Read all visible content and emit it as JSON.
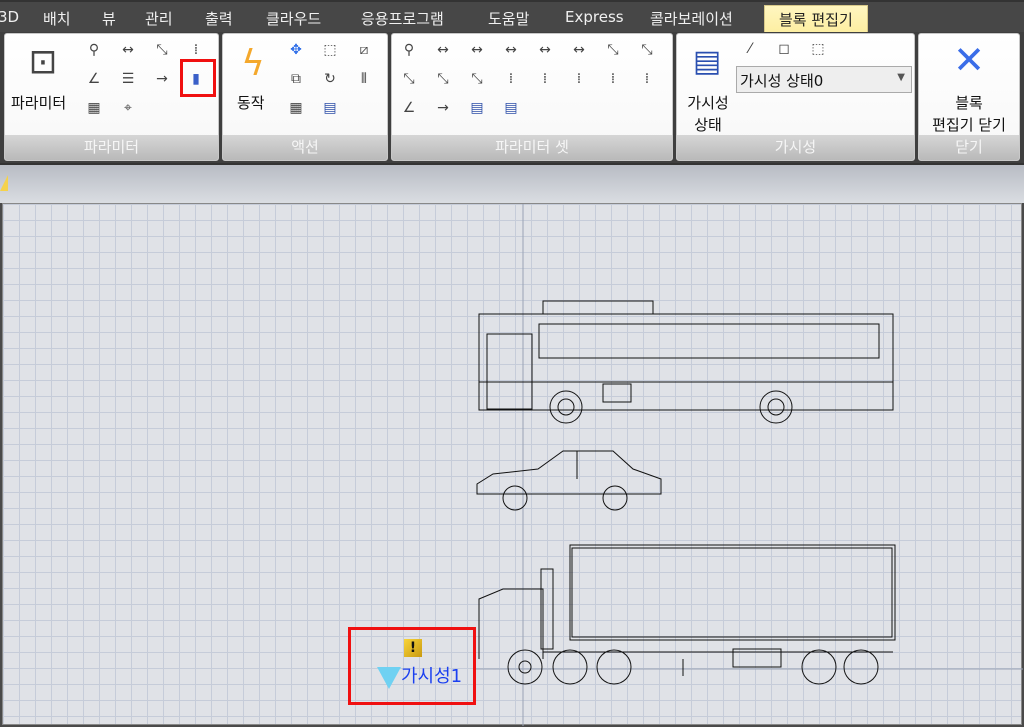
{
  "tabs": [
    "3D",
    "배치",
    "뷰",
    "관리",
    "출력",
    "클라우드",
    "응용프로그램",
    "도움말",
    "Express",
    "콜라보레이션",
    "블록 편집기"
  ],
  "active_tab": "블록 편집기",
  "panels": {
    "parameter": {
      "label": "파라미터",
      "big_button": "파라미터"
    },
    "action": {
      "label": "액션",
      "big_button": "동작"
    },
    "parameter_set": {
      "label": "파라미터 셋"
    },
    "visibility": {
      "label": "가시성",
      "big_button_line1": "가시성",
      "big_button_line2": "상태",
      "state_select": "가시성 상태0"
    },
    "close": {
      "label": "닫기",
      "button_line1": "블록",
      "button_line2": "편집기 닫기"
    }
  },
  "canvas": {
    "visibility_parameter_label": "가시성1"
  },
  "colors": {
    "highlight": "#f01010",
    "accent_blue": "#3a6de8",
    "bolt": "#f4a82c"
  }
}
